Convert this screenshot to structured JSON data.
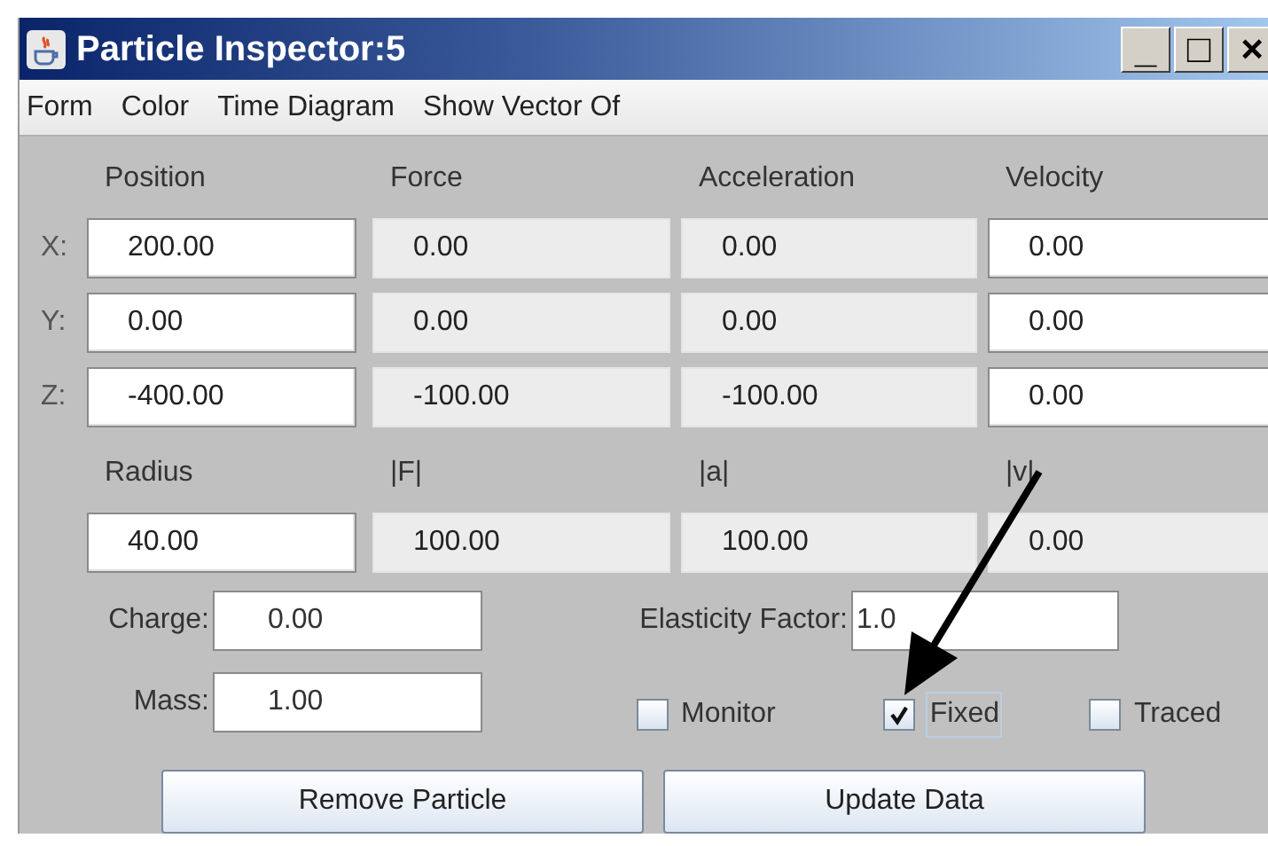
{
  "window": {
    "title": "Particle Inspector:5",
    "controls": [
      "_",
      "□",
      "×"
    ]
  },
  "menu": [
    "Form",
    "Color",
    "Time Diagram",
    "Show Vector Of"
  ],
  "vectors": {
    "columns": [
      "Position",
      "Force",
      "Acceleration",
      "Velocity"
    ],
    "rows": [
      {
        "label": "X:",
        "cells": [
          {
            "value": "200.00",
            "editable": true
          },
          {
            "value": "0.00",
            "editable": false
          },
          {
            "value": "0.00",
            "editable": false
          },
          {
            "value": "0.00",
            "editable": true
          }
        ]
      },
      {
        "label": "Y:",
        "cells": [
          {
            "value": "0.00",
            "editable": true
          },
          {
            "value": "0.00",
            "editable": false
          },
          {
            "value": "0.00",
            "editable": false
          },
          {
            "value": "0.00",
            "editable": true
          }
        ]
      },
      {
        "label": "Z:",
        "cells": [
          {
            "value": "-400.00",
            "editable": true
          },
          {
            "value": "-100.00",
            "editable": false
          },
          {
            "value": "-100.00",
            "editable": false
          },
          {
            "value": "0.00",
            "editable": true
          }
        ]
      }
    ]
  },
  "magnitudes": {
    "columns": [
      "Radius",
      "|F|",
      "|a|",
      "|v|"
    ],
    "cells": [
      {
        "value": "40.00",
        "editable": true
      },
      {
        "value": "100.00",
        "editable": false
      },
      {
        "value": "100.00",
        "editable": false
      },
      {
        "value": "0.00",
        "editable": false
      }
    ]
  },
  "charge": {
    "label": "Charge:",
    "value": "0.00"
  },
  "elasticity": {
    "label": "Elasticity Factor:",
    "value": "1.0"
  },
  "mass": {
    "label": "Mass:",
    "value": "1.00"
  },
  "checkboxes": [
    {
      "label": "Monitor",
      "checked": false
    },
    {
      "label": "Fixed",
      "checked": true
    },
    {
      "label": "Traced",
      "checked": false
    }
  ],
  "buttons": [
    "Remove Particle",
    "Update Data"
  ]
}
